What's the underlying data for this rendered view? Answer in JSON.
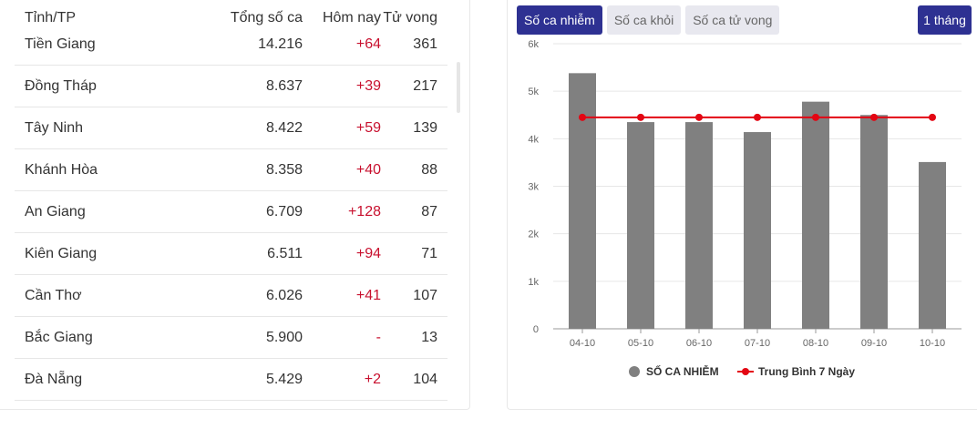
{
  "table": {
    "headers": {
      "name": "Tỉnh/TP",
      "total": "Tổng số ca",
      "today": "Hôm nay",
      "deaths": "Tử vong"
    },
    "rows": [
      {
        "name": "Tiền Giang",
        "total": "14.216",
        "today": "+64",
        "deaths": "361"
      },
      {
        "name": "Đồng Tháp",
        "total": "8.637",
        "today": "+39",
        "deaths": "217"
      },
      {
        "name": "Tây Ninh",
        "total": "8.422",
        "today": "+59",
        "deaths": "139"
      },
      {
        "name": "Khánh Hòa",
        "total": "8.358",
        "today": "+40",
        "deaths": "88"
      },
      {
        "name": "An Giang",
        "total": "6.709",
        "today": "+128",
        "deaths": "87"
      },
      {
        "name": "Kiên Giang",
        "total": "6.511",
        "today": "+94",
        "deaths": "71"
      },
      {
        "name": "Cần Thơ",
        "total": "6.026",
        "today": "+41",
        "deaths": "107"
      },
      {
        "name": "Bắc Giang",
        "total": "5.900",
        "today": "-",
        "deaths": "13"
      },
      {
        "name": "Đà Nẵng",
        "total": "5.429",
        "today": "+2",
        "deaths": "104"
      }
    ]
  },
  "chart_panel": {
    "tabs": [
      {
        "label": "Số ca nhiễm",
        "active": true
      },
      {
        "label": "Số ca khỏi",
        "active": false
      },
      {
        "label": "Số ca tử vong",
        "active": false
      }
    ],
    "range_label": "1 tháng"
  },
  "colors": {
    "accent": "#2e3192",
    "bar": "#808080",
    "line": "#e30613",
    "positive_delta": "#c8102e"
  },
  "chart_data": {
    "type": "bar",
    "categories": [
      "04-10",
      "05-10",
      "06-10",
      "07-10",
      "08-10",
      "09-10",
      "10-10"
    ],
    "series": [
      {
        "name": "SỐ CA NHIỄM",
        "type": "bar",
        "values": [
          5380,
          4350,
          4350,
          4140,
          4780,
          4500,
          3510
        ]
      },
      {
        "name": "Trung Bình 7 Ngày",
        "type": "line",
        "values": [
          4450,
          4450,
          4450,
          4450,
          4450,
          4450,
          4450
        ]
      }
    ],
    "yticks": [
      "0",
      "1k",
      "2k",
      "3k",
      "4k",
      "5k",
      "6k"
    ],
    "ylim": [
      0,
      6000
    ],
    "grid": true,
    "legend": "bottom"
  }
}
